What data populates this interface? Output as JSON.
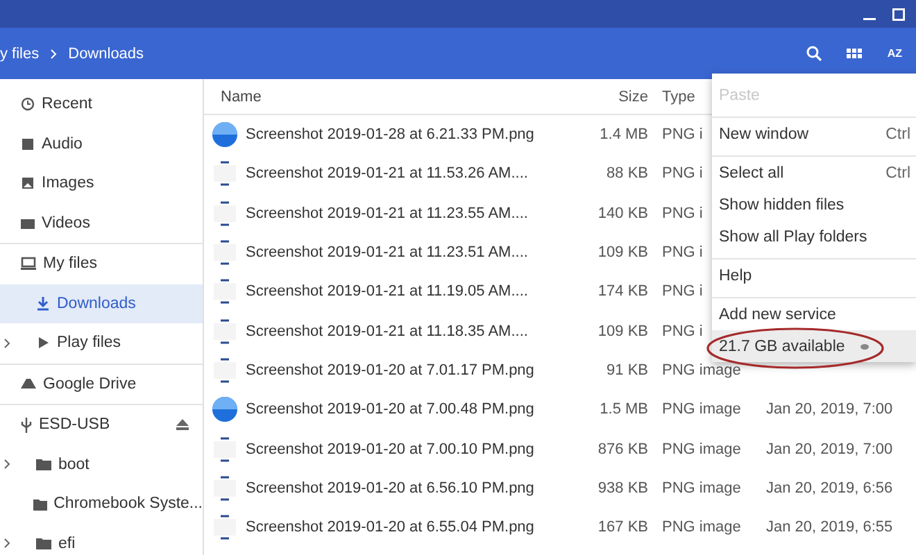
{
  "toolbar": {
    "breadcrumb": [
      "y files",
      "Downloads"
    ],
    "sort_label": "AZ"
  },
  "sidebar": {
    "sections": [
      [
        {
          "label": "Recent",
          "selected": false
        },
        {
          "label": "Audio",
          "selected": false
        },
        {
          "label": "Images",
          "selected": false
        },
        {
          "label": "Videos",
          "selected": false
        }
      ],
      [
        {
          "label": "My files",
          "selected": false,
          "children": [
            {
              "label": "Downloads",
              "selected": true
            },
            {
              "label": "Play files",
              "selected": false,
              "expanded": false
            }
          ]
        }
      ],
      [
        {
          "label": "Google Drive",
          "selected": false
        }
      ],
      [
        {
          "label": "ESD-USB",
          "selected": false,
          "ejectable": true,
          "children": [
            {
              "label": "boot",
              "selected": false,
              "expanded": false
            },
            {
              "label": "Chromebook Syste...",
              "selected": false
            },
            {
              "label": "efi",
              "selected": false,
              "expanded": false
            }
          ]
        }
      ]
    ]
  },
  "table": {
    "columns": [
      "Name",
      "Size",
      "Type"
    ],
    "rows": [
      {
        "kind": "round",
        "name": "Screenshot 2019-01-28 at 6.21.33 PM.png",
        "size": "1.4 MB",
        "type": "PNG i"
      },
      {
        "kind": "page",
        "name": "Screenshot 2019-01-21 at 11.53.26 AM....",
        "size": "88 KB",
        "type": "PNG i"
      },
      {
        "kind": "page",
        "name": "Screenshot 2019-01-21 at 11.23.55 AM....",
        "size": "140 KB",
        "type": "PNG i"
      },
      {
        "kind": "page",
        "name": "Screenshot 2019-01-21 at 11.23.51 AM....",
        "size": "109 KB",
        "type": "PNG i"
      },
      {
        "kind": "page",
        "name": "Screenshot 2019-01-21 at 11.19.05 AM....",
        "size": "174 KB",
        "type": "PNG i"
      },
      {
        "kind": "page",
        "name": "Screenshot 2019-01-21 at 11.18.35 AM....",
        "size": "109 KB",
        "type": "PNG i"
      },
      {
        "kind": "page",
        "name": "Screenshot 2019-01-20 at 7.01.17 PM.png",
        "size": "91 KB",
        "type": "PNG image"
      },
      {
        "kind": "round",
        "name": "Screenshot 2019-01-20 at 7.00.48 PM.png",
        "size": "1.5 MB",
        "type": "PNG image",
        "date": "Jan 20, 2019, 7:00"
      },
      {
        "kind": "page",
        "name": "Screenshot 2019-01-20 at 7.00.10 PM.png",
        "size": "876 KB",
        "type": "PNG image",
        "date": "Jan 20, 2019, 7:00"
      },
      {
        "kind": "page",
        "name": "Screenshot 2019-01-20 at 6.56.10 PM.png",
        "size": "938 KB",
        "type": "PNG image",
        "date": "Jan 20, 2019, 6:56"
      },
      {
        "kind": "page",
        "name": "Screenshot 2019-01-20 at 6.55.04 PM.png",
        "size": "167 KB",
        "type": "PNG image",
        "date": "Jan 20, 2019, 6:55"
      }
    ]
  },
  "menu": {
    "sections": [
      [
        {
          "label": "Paste",
          "disabled": true
        }
      ],
      [
        {
          "label": "New window",
          "shortcut": "Ctrl",
          "disabled": false
        }
      ],
      [
        {
          "label": "Select all",
          "shortcut": "Ctrl",
          "disabled": false
        },
        {
          "label": "Show hidden files",
          "disabled": false
        },
        {
          "label": "Show all Play folders",
          "disabled": false
        }
      ],
      [
        {
          "label": "Help",
          "disabled": false
        }
      ],
      [
        {
          "label": "Add new service",
          "disabled": false
        },
        {
          "label": "21.7 GB available",
          "disabled": false,
          "kind": "storage",
          "highlighted": true
        }
      ]
    ]
  }
}
